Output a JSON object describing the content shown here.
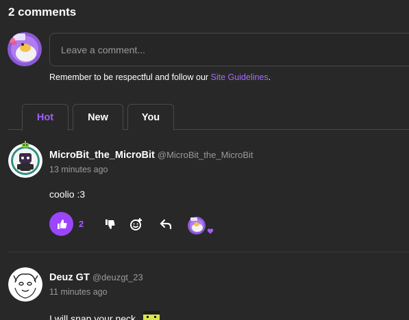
{
  "comments_header": {
    "title": "2 comments"
  },
  "composer": {
    "placeholder": "Leave a comment...",
    "guideline_prefix": "Remember to be respectful and follow our ",
    "guideline_link": "Site Guidelines",
    "guideline_suffix": "."
  },
  "tabs": [
    {
      "label": "Hot",
      "active": true
    },
    {
      "label": "New",
      "active": false
    },
    {
      "label": "You",
      "active": false
    }
  ],
  "comments": [
    {
      "name": "MicroBit_the_MicroBit",
      "handle": "@MicroBit_the_MicroBit",
      "time": "13 minutes ago",
      "text": "coolio :3",
      "likes": "2"
    },
    {
      "name": "Deuz GT",
      "handle": "@deuzgt_23",
      "time": "11 minutes ago",
      "text": "I will snap your neck."
    }
  ],
  "colors": {
    "background": "#282828",
    "accent": "#a35cff",
    "like_button": "#9b45ff",
    "muted_text": "#9a9a9a",
    "border": "#4a4a4a"
  },
  "icons": {
    "like": "thumbs-up-icon",
    "dislike": "thumbs-down-icon",
    "react": "add-reaction-icon",
    "reply": "reply-icon",
    "reaction_heart": "heart-icon"
  }
}
